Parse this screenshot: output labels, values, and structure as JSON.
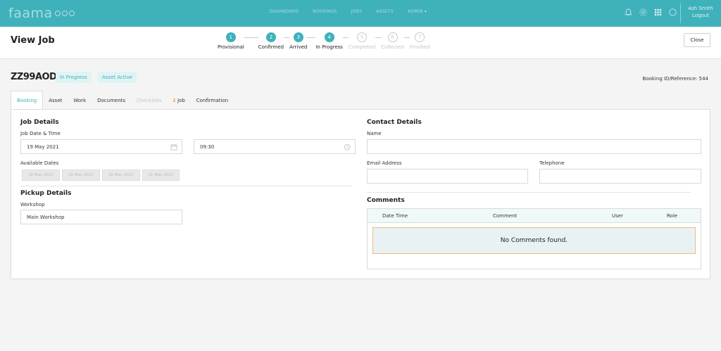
{
  "app": {
    "logo_text": "faama",
    "nav": [
      "DASHBOARD",
      "BOOKINGS",
      "JOBS",
      "ASSETS",
      "ADMIN"
    ],
    "user": {
      "name": "Ash Smith",
      "logout": "Logout"
    }
  },
  "header": {
    "title": "View Job",
    "close_label": "Close",
    "steps": [
      {
        "num": "1",
        "label": "Provisional",
        "state": "done"
      },
      {
        "num": "2",
        "label": "Confirmed",
        "state": "done"
      },
      {
        "num": "3",
        "label": "Arrived",
        "state": "done"
      },
      {
        "num": "4",
        "label": "In Progress",
        "state": "current"
      },
      {
        "num": "5",
        "label": "Completed",
        "state": "inactive"
      },
      {
        "num": "6",
        "label": "Collected",
        "state": "inactive"
      },
      {
        "num": "7",
        "label": "Finished",
        "state": "inactive"
      }
    ]
  },
  "job": {
    "id": "ZZ99AOD",
    "status_badge": "In Progress",
    "asset_badge": "Asset Active",
    "booking_ref": "Booking ID/Reference: 544"
  },
  "tabs": {
    "booking": "Booking",
    "asset": "Asset",
    "work": "Work",
    "documents": "Documents",
    "checklists": "Checklists",
    "job_pound": "£",
    "job": "Job",
    "confirmation": "Confirmation"
  },
  "job_details": {
    "title": "Job Details",
    "datetime_label": "Job Date & Time",
    "date_value": "19 May 2021",
    "time_value": "09:30",
    "available_label": "Available Dates",
    "available_dates": [
      "18 May 2021",
      "19 May 2021",
      "20 May 2021",
      "21 May 2021"
    ]
  },
  "pickup": {
    "title": "Pickup Details",
    "workshop_label": "Workshop",
    "workshop_value": "Main Workshop"
  },
  "contact": {
    "title": "Contact Details",
    "name_label": "Name",
    "email_label": "Email Address",
    "phone_label": "Telephone"
  },
  "comments": {
    "title": "Comments",
    "columns": [
      "Date Time",
      "Comment",
      "User",
      "Role"
    ],
    "empty_text": "No Comments found."
  },
  "colors": {
    "brand": "#3fb1bb",
    "accent_orange": "#e58a2f"
  }
}
